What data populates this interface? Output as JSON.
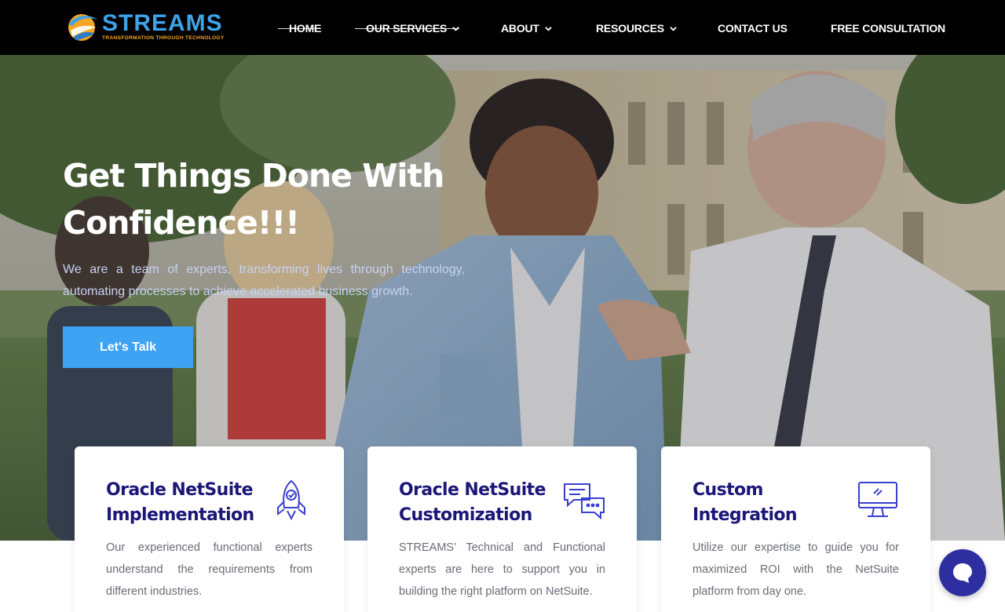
{
  "brand": {
    "name": "STREAMS",
    "tagline": "TRANSFORMATION THROUGH TECHNOLOGY",
    "primary_color": "#3ea3e8",
    "accent_color": "#f5a623"
  },
  "nav": {
    "items": [
      {
        "label": "HOME",
        "dropdown": false
      },
      {
        "label": "OUR SERVICES",
        "dropdown": true
      },
      {
        "label": "ABOUT",
        "dropdown": true
      },
      {
        "label": "RESOURCES",
        "dropdown": true
      },
      {
        "label": "CONTACT US",
        "dropdown": false
      },
      {
        "label": "FREE CONSULTATION",
        "dropdown": false
      }
    ]
  },
  "hero": {
    "title": "Get Things Done With Confidence!!!",
    "subtitle": "We are a team of experts, transforming lives through technology, automating processes to achieve accelerated business growth.",
    "cta_label": "Let's Talk",
    "cta_color": "#3ea3f2"
  },
  "cards": [
    {
      "title": "Oracle NetSuite Implementation",
      "text": "Our experienced functional experts understand the requirements from different industries.",
      "icon": "rocket-icon"
    },
    {
      "title": "Oracle NetSuite Customization",
      "text": "STREAMS’ Technical and Functional experts are here to support you in building the right platform on NetSuite.",
      "icon": "chat-bubbles-icon"
    },
    {
      "title": "Custom Integration",
      "text": "Utilize our expertise to guide you for maximized ROI with the NetSuite platform from day one.",
      "icon": "monitor-icon"
    }
  ],
  "colors": {
    "card_title": "#1c1777",
    "card_icon": "#3a3fd0",
    "chat_widget": "#2d2fa1"
  },
  "chat_widget": {
    "icon": "chat-icon"
  }
}
